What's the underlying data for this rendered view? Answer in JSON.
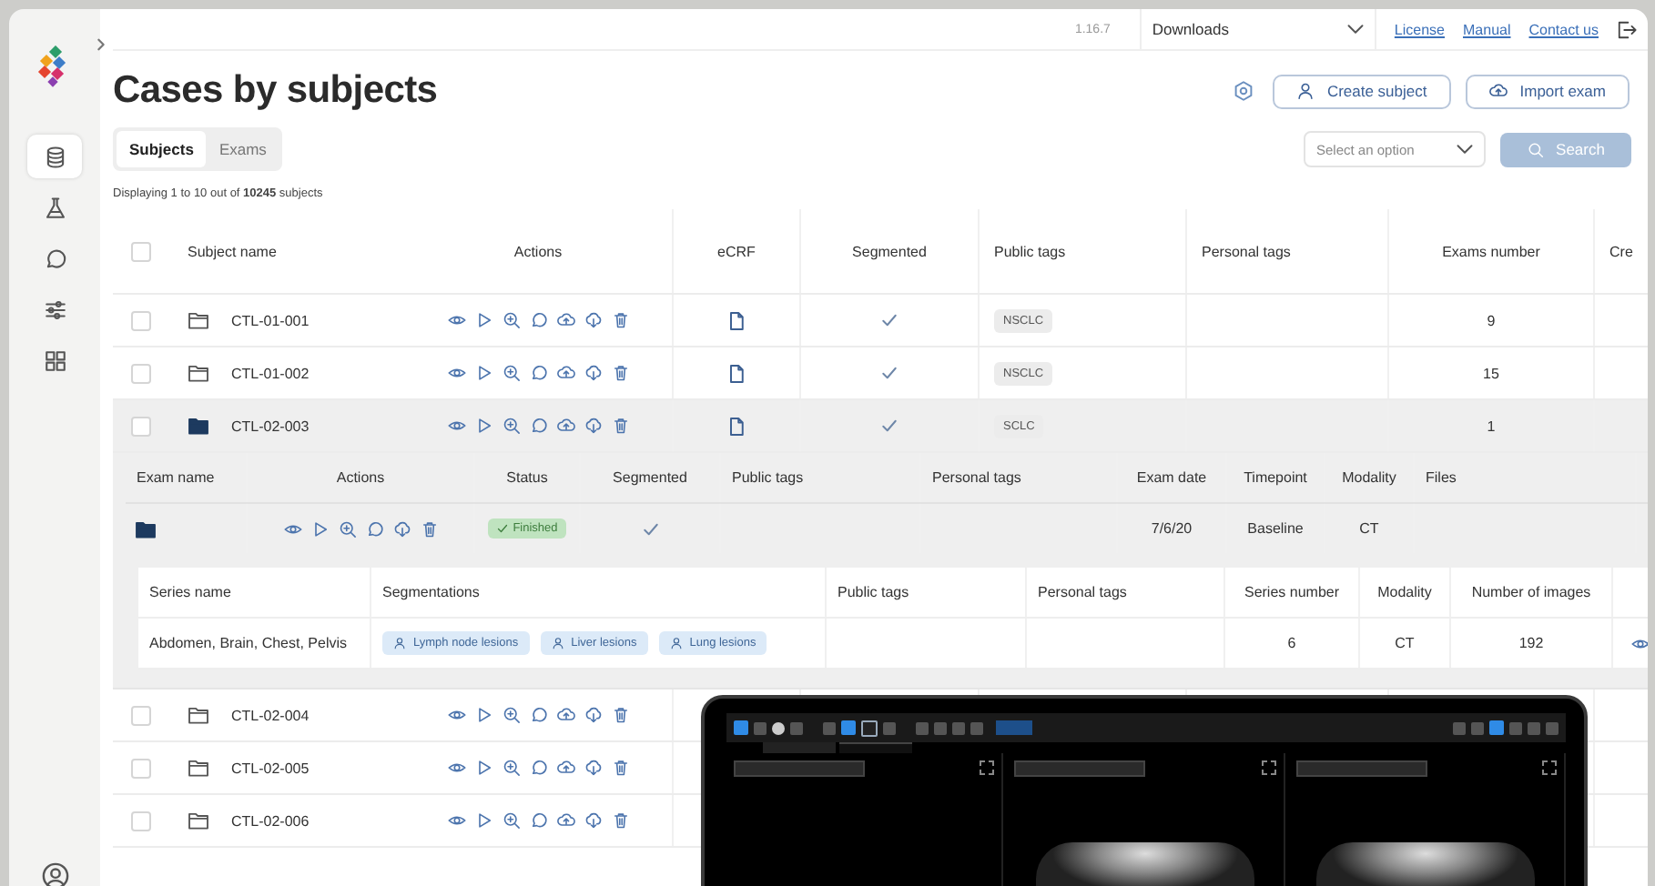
{
  "top_bar": {
    "version": "1.16.7",
    "downloads": "Downloads",
    "links": [
      "License",
      "Manual",
      "Contact us"
    ]
  },
  "sidebar": {
    "items": [
      {
        "kind": "database",
        "selected": true
      },
      {
        "kind": "flask",
        "selected": false
      },
      {
        "kind": "chat",
        "selected": false
      },
      {
        "kind": "sliders",
        "selected": false
      },
      {
        "kind": "grid",
        "selected": false
      }
    ]
  },
  "page": {
    "title": "Cases by subjects",
    "buttons": [
      {
        "kind": "person",
        "label": "Create subject"
      },
      {
        "kind": "cloud",
        "label": "Import exam"
      }
    ]
  },
  "tabs": [
    {
      "label": "Subjects",
      "selected": true
    },
    {
      "label": "Exams",
      "selected": false
    }
  ],
  "filter": {
    "placeholder": "Select an option",
    "search": "Search"
  },
  "summary": "Displaying 1 to 10 out of **10245** subjects",
  "subjects": {
    "select_all": {
      "checked": false
    },
    "columns": [
      "Subject name",
      "Actions",
      "eCRF",
      "Segmented",
      "Public tags",
      "Personal tags",
      "Exams number",
      "Cre"
    ],
    "rows": [
      {
        "name": "CTL-01-001",
        "checked": false,
        "expanded": false,
        "ecrf": true,
        "segmented": true,
        "public_tags": [
          "NSCLC"
        ],
        "exams_number": "9"
      },
      {
        "name": "CTL-01-002",
        "checked": false,
        "expanded": false,
        "ecrf": true,
        "segmented": true,
        "public_tags": [
          "NSCLC"
        ],
        "exams_number": "15"
      },
      {
        "name": "CTL-02-003",
        "checked": false,
        "expanded": true,
        "ecrf": true,
        "segmented": true,
        "public_tags": [
          "SCLC"
        ],
        "exams_number": "1"
      },
      {
        "name": "CTL-02-004",
        "checked": false,
        "expanded": false
      },
      {
        "name": "CTL-02-005",
        "checked": false,
        "expanded": false
      },
      {
        "name": "CTL-02-006",
        "checked": false,
        "expanded": false
      }
    ]
  },
  "exams": {
    "columns": [
      "Exam name",
      "Actions",
      "Status",
      "Segmented",
      "Public tags",
      "Personal tags",
      "Exam date",
      "Timepoint",
      "Modality",
      "Files"
    ],
    "rows": [
      {
        "status": "Finished",
        "segmented": true,
        "exam_date": "7/6/20",
        "timepoint": "Baseline",
        "modality": "CT"
      }
    ]
  },
  "series": {
    "columns": [
      "Series name",
      "Segmentations",
      "Public tags",
      "Personal tags",
      "Series number",
      "Modality",
      "Number of images"
    ],
    "rows": [
      {
        "name": "Abdomen, Brain, Chest, Pelvis",
        "segmentations": [
          "Lymph node lesions",
          "Liver lesions",
          "Lung lesions"
        ],
        "series_number": "6",
        "modality": "CT",
        "number_of_images": "192"
      }
    ]
  }
}
